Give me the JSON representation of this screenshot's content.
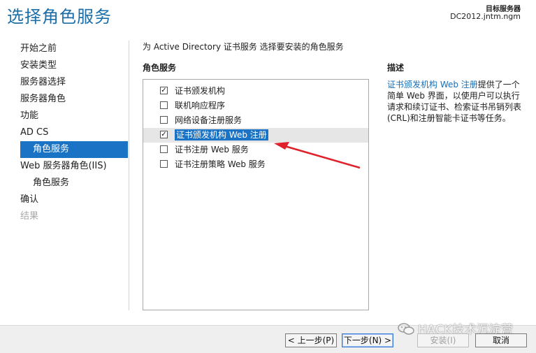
{
  "header": {
    "title": "选择角色服务",
    "dest_label": "目标服务器",
    "dest_value": "DC2012.jntm.ngm"
  },
  "nav": {
    "items": [
      {
        "label": "开始之前"
      },
      {
        "label": "安装类型"
      },
      {
        "label": "服务器选择"
      },
      {
        "label": "服务器角色"
      },
      {
        "label": "功能"
      },
      {
        "label": "AD CS"
      },
      {
        "label": "角色服务"
      },
      {
        "label": "Web 服务器角色(IIS)"
      },
      {
        "label": "角色服务"
      },
      {
        "label": "确认"
      },
      {
        "label": "结果"
      }
    ]
  },
  "main": {
    "intro": "为 Active Directory 证书服务 选择要安装的角色服务",
    "section_head": "角色服务",
    "roles": [
      {
        "label": "证书颁发机构",
        "checked": true
      },
      {
        "label": "联机响应程序",
        "checked": false
      },
      {
        "label": "网络设备注册服务",
        "checked": false
      },
      {
        "label": "证书颁发机构 Web 注册",
        "checked": true
      },
      {
        "label": "证书注册 Web 服务",
        "checked": false
      },
      {
        "label": "证书注册策略 Web 服务",
        "checked": false
      }
    ],
    "check_glyph": "✓"
  },
  "description": {
    "head": "描述",
    "link": "证书颁发机构 Web 注册",
    "text": "提供了一个简单 Web 界面，以使用户可以执行请求和续订证书、检索证书吊销列表(CRL)和注册智能卡证书等任务。"
  },
  "footer": {
    "prev": "< 上一步(P)",
    "next": "下一步(N) >",
    "install": "安装(I)",
    "cancel": "取消"
  },
  "watermark": "HACK技术沉淀营",
  "colors": {
    "accent": "#1a73c4",
    "title": "#1b6ea8",
    "arrow": "#e0202a"
  }
}
